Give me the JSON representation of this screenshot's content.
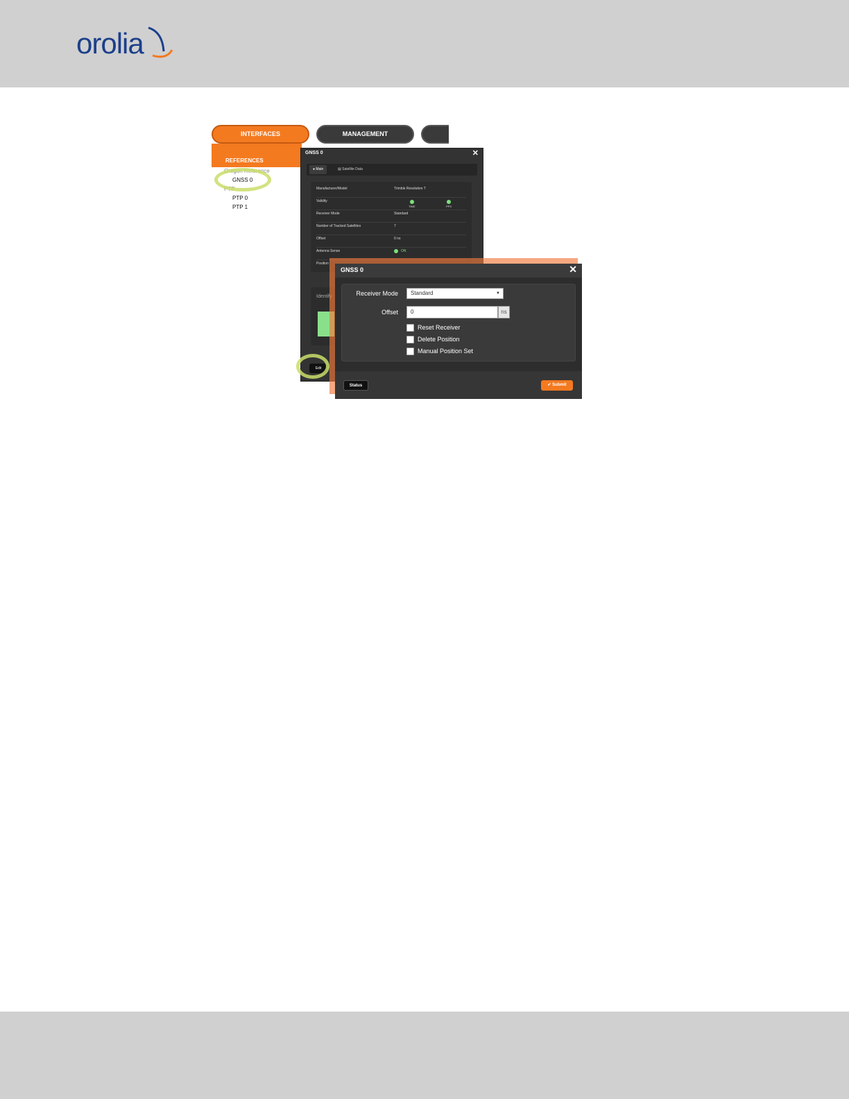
{
  "brand": {
    "logo_text": "orolia",
    "accent": "#f47a20",
    "logo_color": "#1c3f8c"
  },
  "nav": {
    "interfaces": "INTERFACES",
    "management": "MANAGEMENT"
  },
  "sidebar": {
    "section": "REFERENCES",
    "group": "Oregon Reference",
    "items": [
      "GNSS 0",
      "PTP",
      "PTP 0",
      "PTP 1"
    ]
  },
  "status_modal": {
    "title": "GNSS 0",
    "close": "✕",
    "tabs": [
      "Main",
      "Satellite Data"
    ],
    "rows": [
      {
        "key": "Manufacturer/Model",
        "value": "Trimble Resolution T"
      },
      {
        "key": "Validity",
        "value": ""
      },
      {
        "key": "Receiver Mode",
        "value": "Standard"
      },
      {
        "key": "Number of Tracked Satellites",
        "value": "7"
      },
      {
        "key": "Offset",
        "value": "0 ns"
      },
      {
        "key": "Antenna Sense",
        "value": "ON"
      },
      {
        "key": "Position",
        "value": ""
      }
    ],
    "validity_labels": [
      "TIME",
      "PPS"
    ],
    "identify_label": "Identify",
    "edit_button": "Edit"
  },
  "edit_modal": {
    "title": "GNSS 0",
    "close": "✕",
    "receiver_mode_label": "Receiver Mode",
    "receiver_mode_value": "Standard",
    "offset_label": "Offset",
    "offset_value": "0",
    "offset_unit": "ns",
    "checkboxes": [
      "Reset Receiver",
      "Delete Position",
      "Manual Position Set"
    ],
    "status_button": "Status",
    "submit_button": "✔ Submit"
  }
}
